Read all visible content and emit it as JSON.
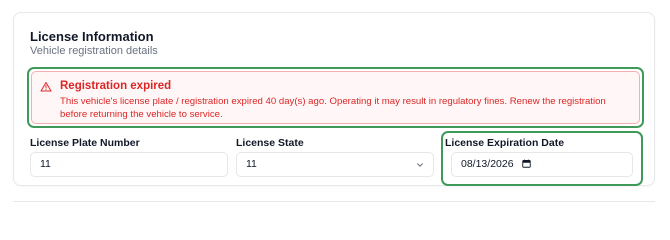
{
  "card": {
    "title": "License Information",
    "subtitle": "Vehicle registration details"
  },
  "alert": {
    "icon": "warning-triangle-icon",
    "title": "Registration expired",
    "message": "This vehicle's license plate / registration expired 40 day(s) ago. Operating it may result in regulatory fines. Renew the registration before returning the vehicle to service.",
    "color": "#dc2626"
  },
  "fields": {
    "plate": {
      "label": "License Plate Number",
      "value": "11"
    },
    "state": {
      "label": "License State",
      "value": "11",
      "icon": "chevron-down-icon"
    },
    "expiration": {
      "label": "License Expiration Date",
      "value": "08/13/2026",
      "icon": "calendar-icon"
    }
  },
  "colors": {
    "focus_ring": "#3f9a5a",
    "error": "#dc2626",
    "border": "#e6e8ec"
  }
}
